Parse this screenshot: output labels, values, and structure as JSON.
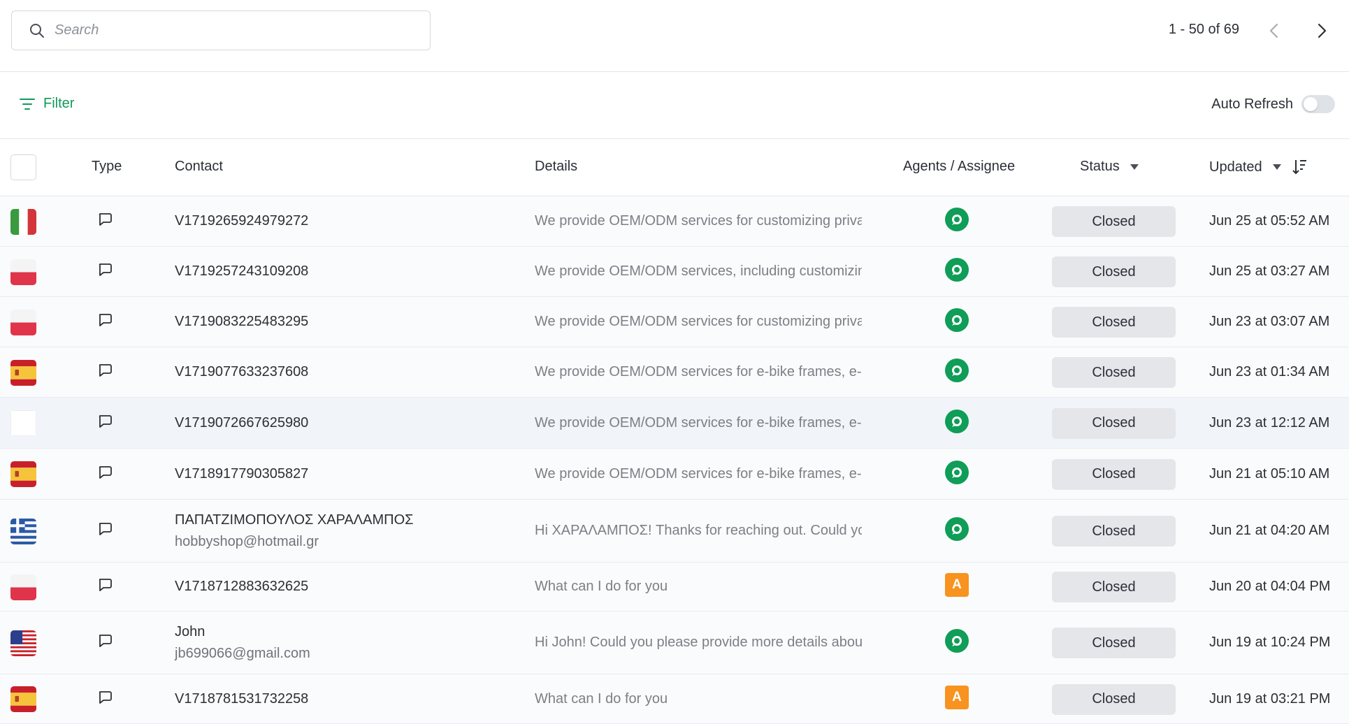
{
  "search": {
    "placeholder": "Search"
  },
  "pagination": {
    "text": "1 - 50 of 69"
  },
  "filter": {
    "label": "Filter"
  },
  "auto_refresh": {
    "label": "Auto Refresh",
    "enabled": false
  },
  "columns": {
    "type": "Type",
    "contact": "Contact",
    "details": "Details",
    "agents": "Agents / Assignee",
    "status": "Status",
    "updated": "Updated"
  },
  "colors": {
    "accent": "#119a5a",
    "bot": "#0f9d58",
    "assignee": "#f7931e",
    "status_bg": "#e4e6ea"
  },
  "rows": [
    {
      "flag": "italy-flag-icon",
      "contact": "V1719265924979272",
      "contact_sub": "",
      "details": "We provide OEM/ODM services for customizing privat",
      "agent": "bot",
      "agent_label": "",
      "status": "Closed",
      "updated": "Jun 25 at 05:52 AM"
    },
    {
      "flag": "poland-flag-icon",
      "contact": "V1719257243109208",
      "contact_sub": "",
      "details": "We provide OEM/ODM services, including customizing",
      "agent": "bot",
      "agent_label": "",
      "status": "Closed",
      "updated": "Jun 25 at 03:27 AM"
    },
    {
      "flag": "poland-flag-icon",
      "contact": "V1719083225483295",
      "contact_sub": "",
      "details": "We provide OEM/ODM services for customizing privat",
      "agent": "bot",
      "agent_label": "",
      "status": "Closed",
      "updated": "Jun 23 at 03:07 AM"
    },
    {
      "flag": "spain-flag-icon",
      "contact": "V1719077633237608",
      "contact_sub": "",
      "details": "We provide OEM/ODM services for e-bike frames, e-bil",
      "agent": "bot",
      "agent_label": "",
      "status": "Closed",
      "updated": "Jun 23 at 01:34 AM"
    },
    {
      "flag": "blank-flag-icon",
      "contact": "V1719072667625980",
      "contact_sub": "",
      "details": "We provide OEM/ODM services for e-bike frames, e-bil",
      "agent": "bot",
      "agent_label": "",
      "status": "Closed",
      "updated": "Jun 23 at 12:12 AM"
    },
    {
      "flag": "spain-flag-icon",
      "contact": "V1718917790305827",
      "contact_sub": "",
      "details": "We provide OEM/ODM services for e-bike frames, e-bil",
      "agent": "bot",
      "agent_label": "",
      "status": "Closed",
      "updated": "Jun 21 at 05:10 AM"
    },
    {
      "flag": "greece-flag-icon",
      "contact": "ΠΑΠΑΤΖΙΜΟΠΟΥΛΟΣ ΧΑΡΑΛΑΜΠΟΣ",
      "contact_sub": "hobbyshop@hotmail.gr",
      "details": "Hi ΧΑΡΑΛΑΜΠΟΣ! Thanks for reaching out. Could you",
      "agent": "bot",
      "agent_label": "",
      "status": "Closed",
      "updated": "Jun 21 at 04:20 AM"
    },
    {
      "flag": "poland-flag-icon",
      "contact": "V1718712883632625",
      "contact_sub": "",
      "details": "What can I do for you",
      "agent": "letter",
      "agent_label": "A",
      "status": "Closed",
      "updated": "Jun 20 at 04:04 PM"
    },
    {
      "flag": "usa-flag-icon",
      "contact": "John",
      "contact_sub": "jb699066@gmail.com",
      "details": "Hi John! Could you please provide more details about w",
      "agent": "bot",
      "agent_label": "",
      "status": "Closed",
      "updated": "Jun 19 at 10:24 PM"
    },
    {
      "flag": "spain-flag-icon",
      "contact": "V1718781531732258",
      "contact_sub": "",
      "details": "What can I do for you",
      "agent": "letter",
      "agent_label": "A",
      "status": "Closed",
      "updated": "Jun 19 at 03:21 PM"
    }
  ]
}
